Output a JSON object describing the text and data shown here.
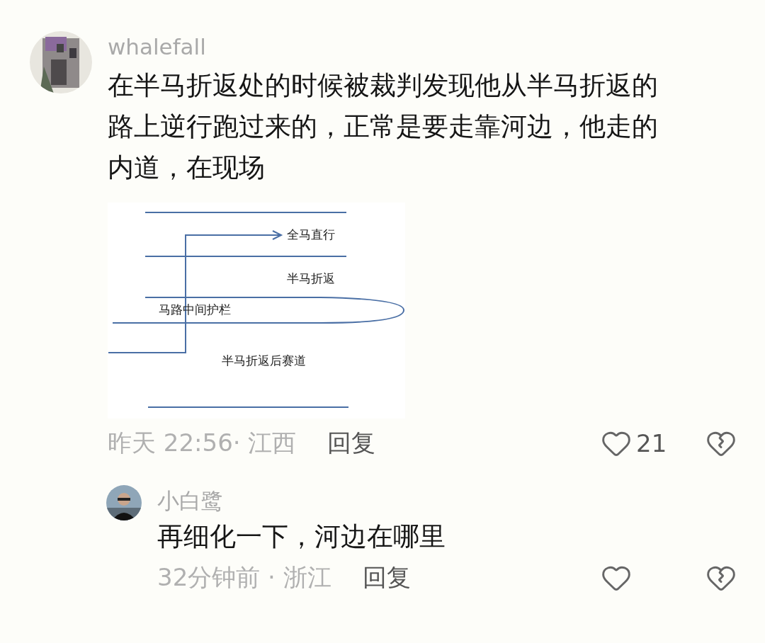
{
  "comments": [
    {
      "user": "whalefall",
      "text_lines": [
        "在半马折返处的时候被裁判发现他从半马折返的",
        "路上逆行跑过来的，正常是要走靠河边，他走的",
        "内道，在现场"
      ],
      "diagram": {
        "labels": [
          "全马直行",
          "半马折返",
          "马路中间护栏",
          "半马折返后赛道"
        ]
      },
      "time": "昨天 22:56· 江西",
      "reply": "回复",
      "likes": "21"
    },
    {
      "user": "小白鹭",
      "text_lines": [
        "再细化一下，河边在哪里"
      ],
      "time": "32分钟前 · 浙江",
      "reply": "回复"
    }
  ]
}
